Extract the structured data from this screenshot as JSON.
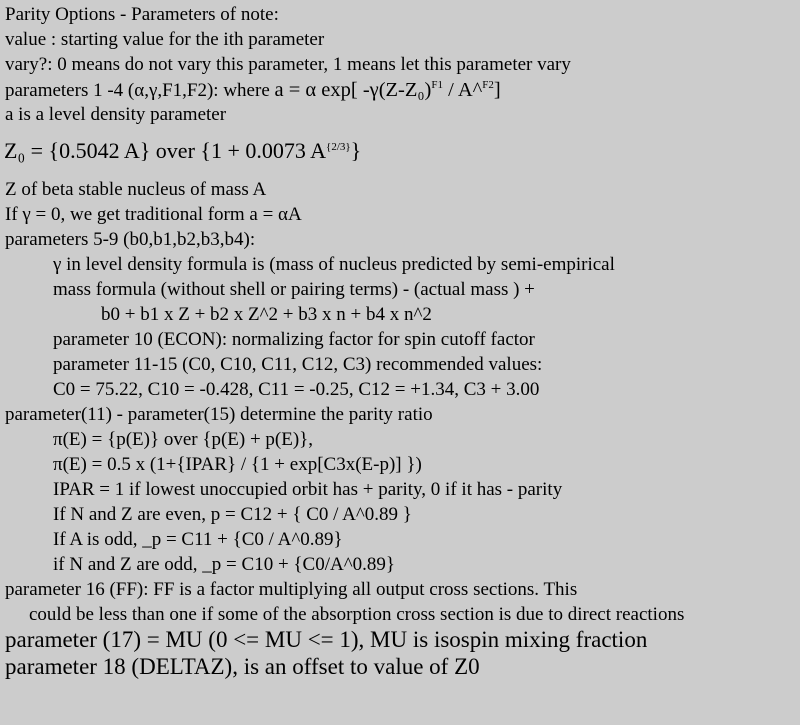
{
  "lines": {
    "l1": "Parity Options - Parameters of note:",
    "l2": "value : starting value for the ith parameter",
    "l3": "vary?: 0 means do not vary this parameter, 1 means let this parameter vary",
    "l4a": "parameters 1 -4 (α,γ,F1,F2): where",
    "l4b": "a = α exp[ -γ(Z-Z₀)",
    "l4c": "F1",
    "l4d": " / A^",
    "l4e": "F2",
    "l4f": "]",
    "l5": "a is a level density parameter",
    "l6a": "Z₀ = {0.5042 A} over {1 + 0.0073 A",
    "l6b": "{2/3}",
    "l6c": "}",
    "l7": "Z of beta stable nucleus of mass A",
    "l8": "If γ = 0, we get traditional form a = αA",
    "l9": "parameters 5-9 (b0,b1,b2,b3,b4):",
    "l10": "γ in level density formula is (mass of nucleus predicted by semi-empirical",
    "l11": "mass formula (without shell or pairing terms) - (actual mass ) +",
    "l12": "b0 + b1 x Z + b2 x Z^2 + b3 x n + b4 x n^2",
    "l13": "parameter 10 (ECON): normalizing factor for spin cutoff factor",
    "l14": "parameter 11-15 (C0, C10, C11, C12, C3) recommended values:",
    "l15": "C0 = 75.22, C10 = -0.428, C11 = -0.25, C12 = +1.34, C3 + 3.00",
    "l16": "parameter(11) - parameter(15) determine the parity ratio",
    "l17": "π(E) = {p(E)} over {p(E) + p(E)},",
    "l18": "π(E) = 0.5 x (1+{IPAR} / {1 + exp[C3x(E-p)] })",
    "l19": "IPAR = 1 if lowest unoccupied orbit has + parity, 0 if it has - parity",
    "l20": "If N and Z are even, p = C12 + { C0 / A^0.89 }",
    "l21": "If A is odd, _p = C11 + {C0 / A^0.89}",
    "l22": "if N and Z are odd, _p = C10 + {C0/A^0.89}",
    "l23": "parameter 16 (FF): FF is a factor multiplying all output cross sections. This",
    "l24": "could be less than one if some of the absorption cross section is due to direct reactions",
    "l25": "parameter (17) = MU (0 <= MU <= 1), MU is isospin mixing fraction",
    "l26": "parameter 18 (DELTAZ), is an offset to value of Z0"
  }
}
